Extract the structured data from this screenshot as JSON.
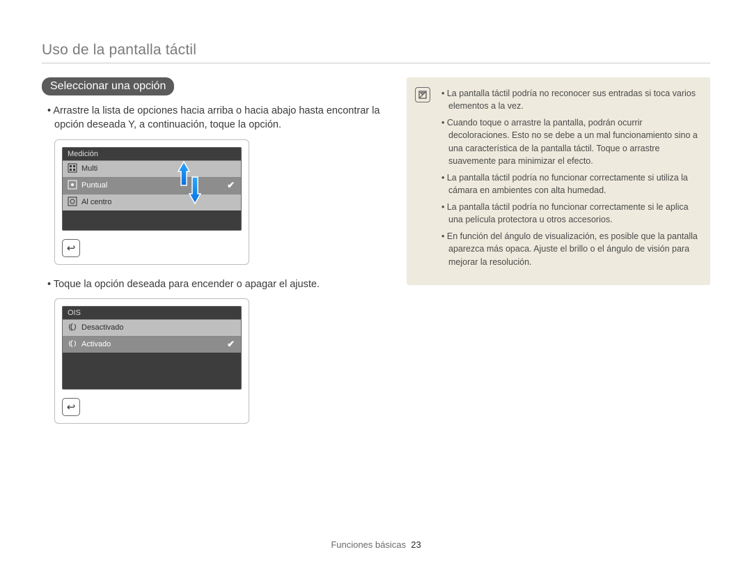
{
  "page_title": "Uso de la pantalla táctil",
  "section_heading": "Seleccionar una opción",
  "instruction_drag": "Arrastre la lista de opciones hacia arriba o hacia abajo hasta encontrar la opción deseada Y, a continuación, toque la opción.",
  "instruction_toggle": "Toque la opción deseada para encender o apagar el ajuste.",
  "screen1": {
    "title": "Medición",
    "rows": {
      "r0": {
        "label": "Multi"
      },
      "r1": {
        "label": "Puntual"
      },
      "r2": {
        "label": "Al centro"
      }
    }
  },
  "screen2": {
    "title": "OIS",
    "rows": {
      "r0": {
        "label": "Desactivado"
      },
      "r1": {
        "label": "Activado"
      }
    }
  },
  "notes": {
    "n0": "La pantalla táctil podría no reconocer sus entradas si toca varios elementos a la vez.",
    "n1": "Cuando toque o arrastre la pantalla, podrán ocurrir decoloraciones. Esto no se debe a un mal funcionamiento sino a una característica de la pantalla táctil. Toque o arrastre suavemente para minimizar el efecto.",
    "n2": "La pantalla táctil podría no funcionar correctamente si utiliza la cámara en ambientes con alta humedad.",
    "n3": "La pantalla táctil podría no funcionar correctamente si le aplica una película protectora u otros accesorios.",
    "n4": "En función del ángulo de visualización, es posible que la pantalla aparezca más opaca. Ajuste el brillo o el ángulo de visión para mejorar la resolución."
  },
  "footer_label": "Funciones básicas",
  "footer_page": "23",
  "icons": {
    "info": "ⓘ",
    "back": "↩"
  }
}
